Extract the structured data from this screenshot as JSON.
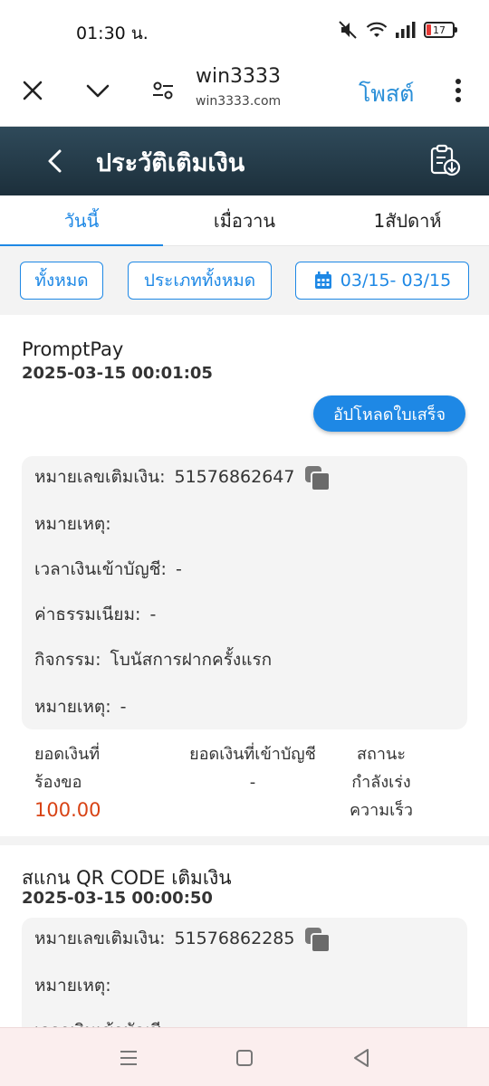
{
  "status": {
    "time": "01:30 น.",
    "battery": "17"
  },
  "browser": {
    "site_title": "win3333",
    "site_url": "win3333.com",
    "post_label": "โพสต์"
  },
  "header": {
    "title": "ประวัติเติมเงิน"
  },
  "tabs": [
    {
      "label": "วันนี้",
      "active": true
    },
    {
      "label": "เมื่อวาน",
      "active": false
    },
    {
      "label": "1สัปดาห์",
      "active": false
    }
  ],
  "filters": {
    "all": "ทั้งหมด",
    "all_types": "ประเภททั้งหมด",
    "date_range": "03/15- 03/15"
  },
  "records": [
    {
      "method": "PromptPay",
      "datetime": "2025-03-15 00:01:05",
      "upload_label": "อัปโหลดใบเสร็จ",
      "rows": {
        "deposit_no_label": "หมายเลขเติมเงิน:",
        "deposit_no": "51576862647",
        "note1_label": "หมายเหตุ:",
        "note1_value": "",
        "credit_time_label": "เวลาเงินเข้าบัญชี:",
        "credit_time_value": "-",
        "fee_label": "ค่าธรรมเนียม:",
        "fee_value": "-",
        "activity_label": "กิจกรรม:",
        "activity_value": "โบนัสการฝากครั้งแรก",
        "note2_label": "หมายเหตุ:",
        "note2_value": "-"
      },
      "summary": {
        "requested_label_1": "ยอดเงินที่",
        "requested_label_2": "ร้องขอ",
        "requested_amount": "100.00",
        "credited_label": "ยอดเงินที่เข้าบัญชี",
        "credited_value": "-",
        "status_label": "สถานะ",
        "status_value_1": "กำลังเร่ง",
        "status_value_2": "ความเร็ว"
      }
    },
    {
      "method": "สแกน QR CODE เติมเงิน",
      "datetime": "2025-03-15 00:00:50",
      "rows": {
        "deposit_no_label": "หมายเลขเติมเงิน:",
        "deposit_no": "51576862285",
        "note1_label": "หมายเหตุ:",
        "credit_time_label": "เวลาเงินเข้าบัญชี:"
      }
    }
  ],
  "colors": {
    "accent": "#1e88e5",
    "header_bg": "#22384a",
    "amount": "#d84315"
  }
}
